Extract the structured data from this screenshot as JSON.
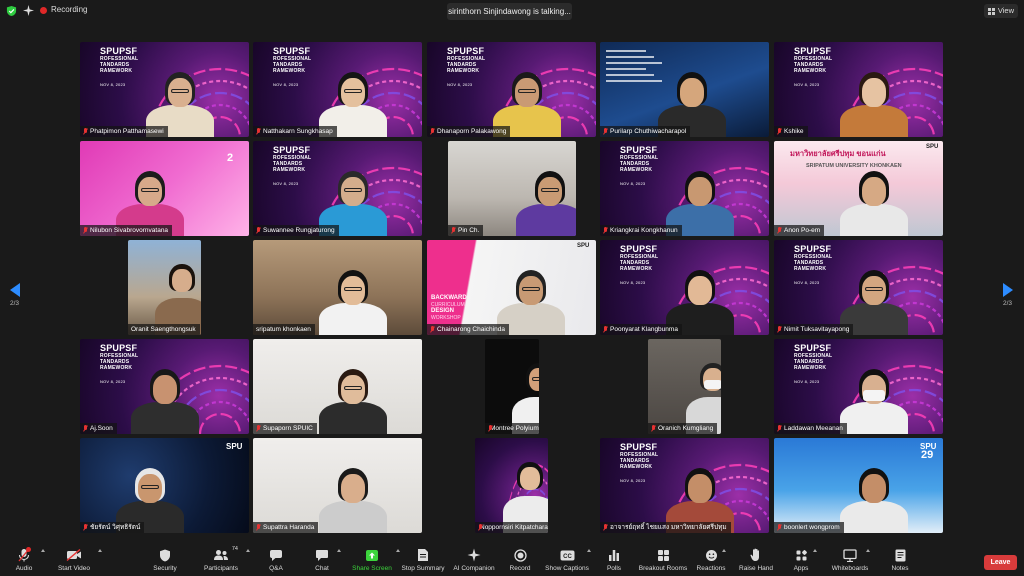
{
  "topbar": {
    "recording_label": "Recording",
    "talking_label": "sirinthorn Sinjindawong is talking...",
    "view_label": "View"
  },
  "brand_logo": {
    "line1": "SPUPSF",
    "line2": "ROFESSIONAL",
    "line3": "TANDARDS",
    "line4": "RAMEWORK",
    "date": "NOV 8, 2023"
  },
  "participants": [
    {
      "name": "Phatpimon Patthamasewi",
      "muted": true
    },
    {
      "name": "Natthakarn Sungkhasap",
      "muted": true
    },
    {
      "name": "Dhanaporn Palakawong",
      "muted": true
    },
    {
      "name": "Purilarp Chuthiwacharapol",
      "muted": true
    },
    {
      "name": "Kshike",
      "muted": true
    },
    {
      "name": "Nilubon Sivabrovornvatana",
      "muted": true
    },
    {
      "name": "Suwannee Rungjaturong",
      "muted": true
    },
    {
      "name": "Pin Ch.",
      "muted": true
    },
    {
      "name": "Kriangkrai Kongkhanun",
      "muted": true
    },
    {
      "name": "Anon Po-em",
      "muted": true
    },
    {
      "name": "Oranit Saengthongsuk",
      "muted": false
    },
    {
      "name": "sripatum khonkaen",
      "muted": false
    },
    {
      "name": "Chainarong Chaichinda",
      "muted": true
    },
    {
      "name": "Poonyarat Klangbunma",
      "muted": true
    },
    {
      "name": "Nimit Tuksavitayapong",
      "muted": true
    },
    {
      "name": "Aj.Soon",
      "muted": true
    },
    {
      "name": "Supaporn SPUIC",
      "muted": true
    },
    {
      "name": "Montree Polyium",
      "muted": true
    },
    {
      "name": "Oranich Kumgliang",
      "muted": true
    },
    {
      "name": "Laddawan Meeanan",
      "muted": true
    },
    {
      "name": "ชัยรัตน์ วิศุทธิรัตน์",
      "muted": true
    },
    {
      "name": "Supattra Haranda",
      "muted": true
    },
    {
      "name": "Noppornsiri Kitpatchara",
      "muted": true
    },
    {
      "name": "อาจารย์ฤทธิ์ ไชยแสง มหาวิทยาลัยศรีปทุม",
      "muted": true
    },
    {
      "name": "boonlert wongprom",
      "muted": true
    }
  ],
  "slide_texts": {
    "backward": "BACKWARD",
    "curriculum": "CURRICULUM",
    "design": "DESIGN",
    "workshop": "WORKSHOP",
    "campus_thai": "มหาวิทยาลัยศรีปทุม ขอนแก่น",
    "campus_en": "SRIPATUM UNIVERSITY KHONKAEN",
    "spu": "SPU",
    "num2": "2",
    "num29": "29"
  },
  "pagination": {
    "left": "2/3",
    "right": "2/3"
  },
  "toolbar": {
    "audio": "Audio",
    "start_video": "Start Video",
    "security": "Security",
    "participants": "Participants",
    "participants_count": "74",
    "qa": "Q&A",
    "chat": "Chat",
    "share_screen": "Share Screen",
    "stop_summary": "Stop Summary",
    "ai_companion": "AI Companion",
    "record": "Record",
    "show_captions": "Show Captions",
    "polls": "Polls",
    "breakout_rooms": "Breakout Rooms",
    "reactions": "Reactions",
    "raise_hand": "Raise Hand",
    "apps": "Apps",
    "whiteboards": "Whiteboards",
    "notes": "Notes",
    "leave": "Leave"
  },
  "colors": {
    "accent_blue": "#2d8cff",
    "share_green": "#3cd43c",
    "leave_red": "#d83b3b",
    "brand_purple": "#571a73"
  }
}
